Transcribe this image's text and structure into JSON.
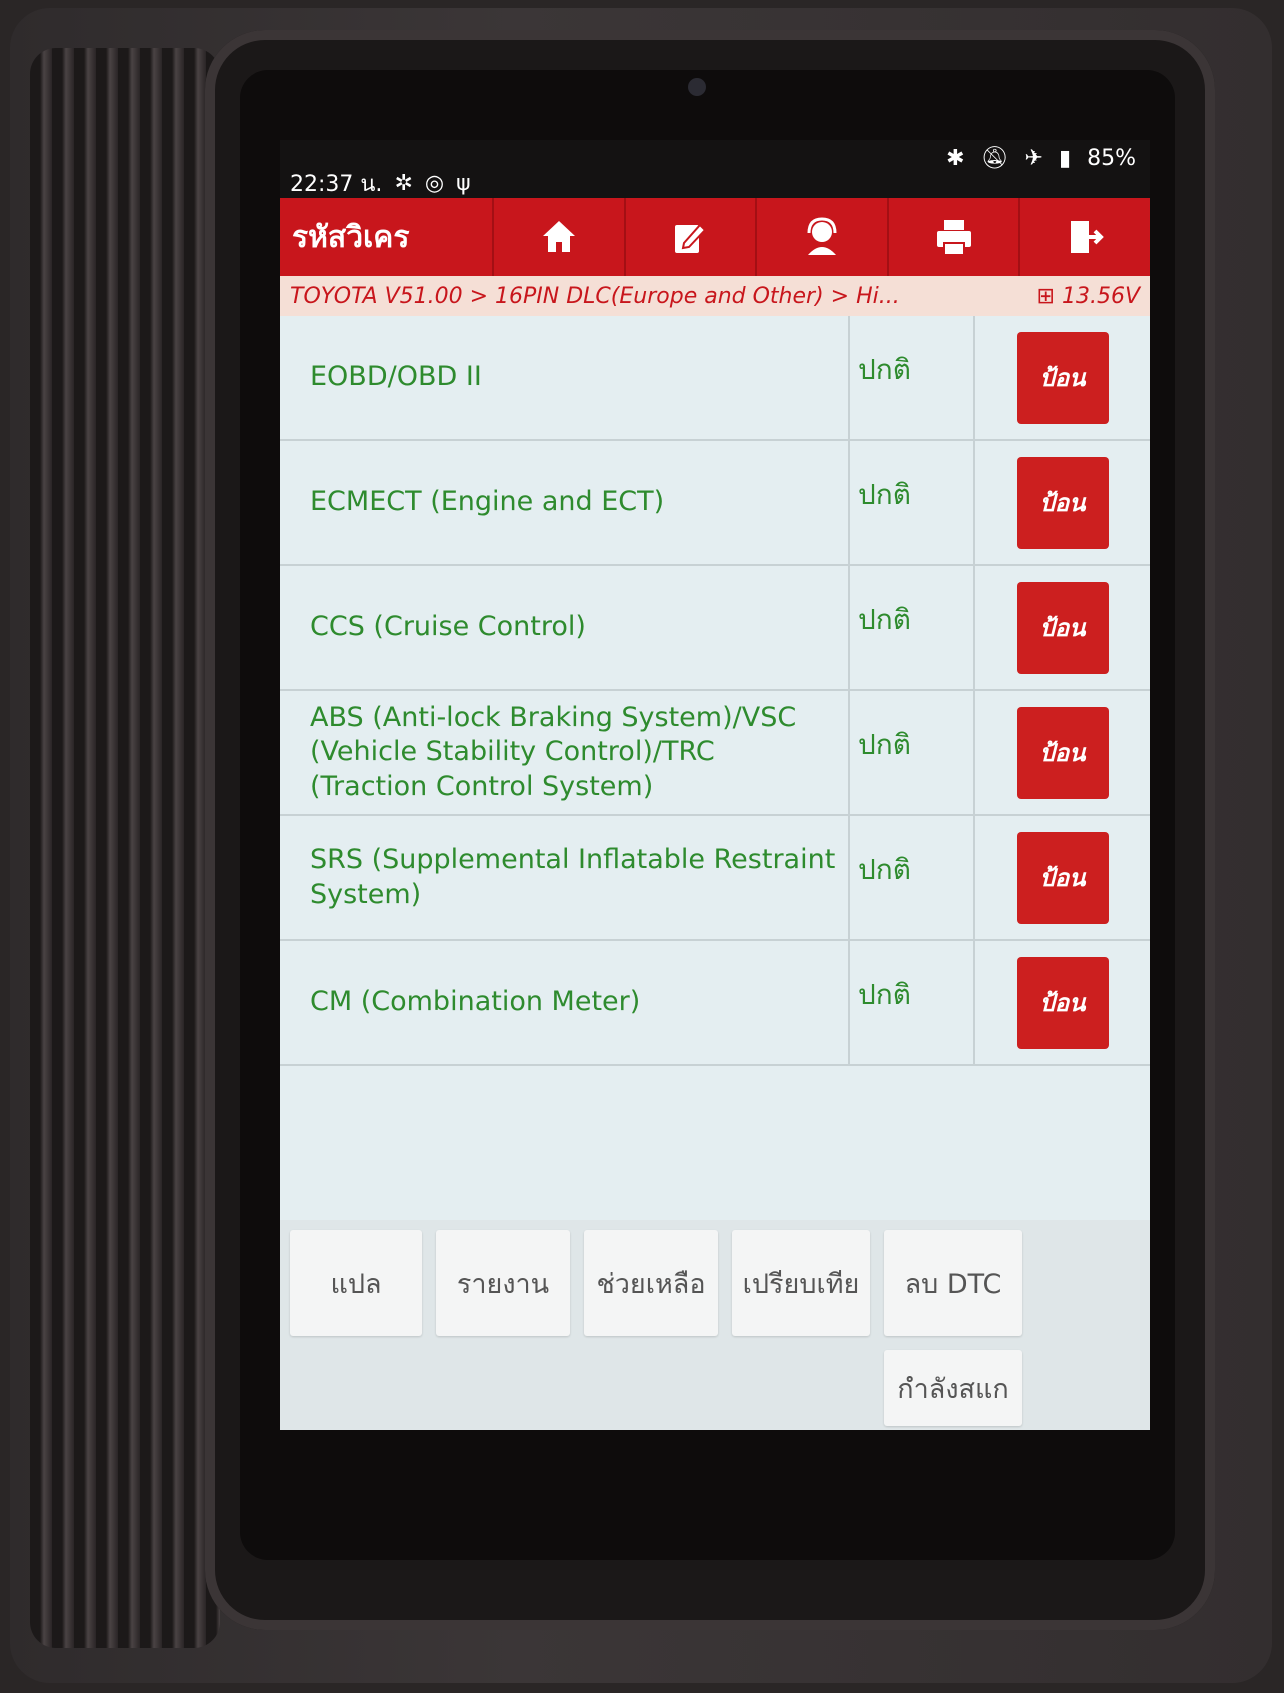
{
  "statusbar": {
    "time": "22:37 น.",
    "battery": "85%"
  },
  "toolbar": {
    "title": "รหัสวิเคร",
    "icons": [
      "home-icon",
      "edit-icon",
      "support-icon",
      "print-icon",
      "exit-icon"
    ]
  },
  "breadcrumb": {
    "path": "TOYOTA V51.00 > 16PIN DLC(Europe and Other) > Hi...",
    "voltage": "13.56V"
  },
  "systems": [
    {
      "name": "EOBD/OBD II",
      "status": "ปกติ",
      "action": "ป้อน"
    },
    {
      "name": "ECMECT (Engine and ECT)",
      "status": "ปกติ",
      "action": "ป้อน"
    },
    {
      "name": "CCS (Cruise Control)",
      "status": "ปกติ",
      "action": "ป้อน"
    },
    {
      "name": "ABS (Anti-lock Braking System)/VSC (Vehicle Stability Control)/TRC (Traction Control System)",
      "status": "ปกติ",
      "action": "ป้อน"
    },
    {
      "name": "SRS (Supplemental Inflatable Restraint System)",
      "status": "ปกติ",
      "action": "ป้อน"
    },
    {
      "name": "CM (Combination Meter)",
      "status": "ปกติ",
      "action": "ป้อน"
    }
  ],
  "footer": {
    "translate": "แปล",
    "report": "รายงาน",
    "help": "ช่วยเหลือ",
    "compare": "เปรียบเทีย",
    "clear_dtc": "ลบ DTC",
    "scanning": "กำลังสแก"
  },
  "colors": {
    "accent": "#c8161c",
    "ok_text": "#2e8b2e",
    "screen_bg": "#e4eef1"
  }
}
